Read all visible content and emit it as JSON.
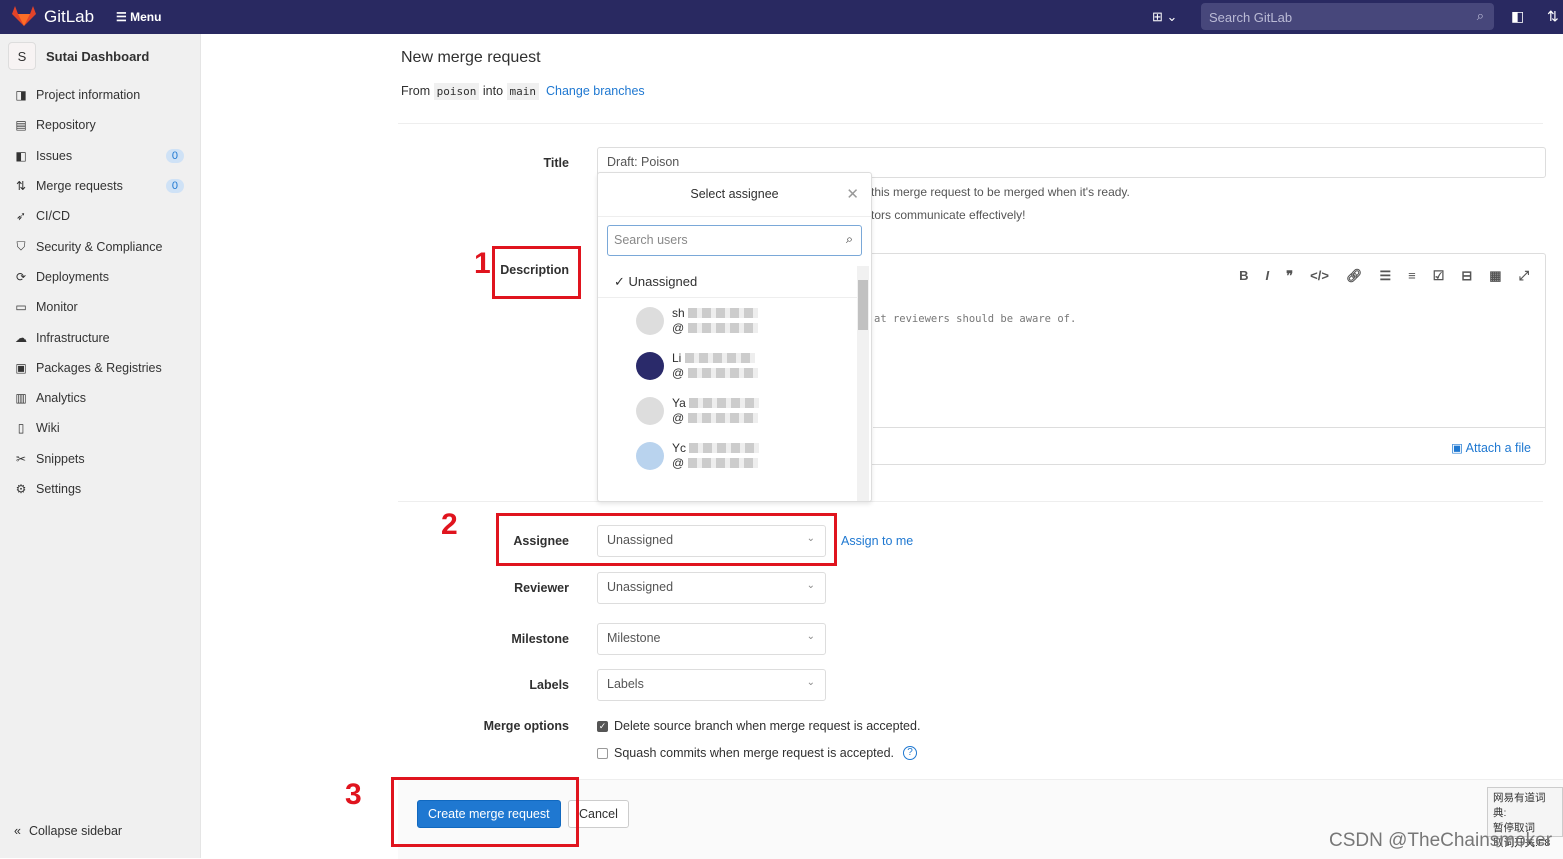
{
  "topbar": {
    "brand": "GitLab",
    "menu": "Menu",
    "search_placeholder": "Search GitLab"
  },
  "sidebar": {
    "project_initial": "S",
    "project_name": "Sutai Dashboard",
    "items": [
      {
        "label": "Project information",
        "icon": "info-icon"
      },
      {
        "label": "Repository",
        "icon": "doc-icon"
      },
      {
        "label": "Issues",
        "icon": "issues-icon",
        "badge": "0"
      },
      {
        "label": "Merge requests",
        "icon": "merge-icon",
        "badge": "0"
      },
      {
        "label": "CI/CD",
        "icon": "rocket-icon"
      },
      {
        "label": "Security & Compliance",
        "icon": "shield-icon"
      },
      {
        "label": "Deployments",
        "icon": "deploy-icon"
      },
      {
        "label": "Monitor",
        "icon": "monitor-icon"
      },
      {
        "label": "Infrastructure",
        "icon": "cloud-icon"
      },
      {
        "label": "Packages & Registries",
        "icon": "package-icon"
      },
      {
        "label": "Analytics",
        "icon": "chart-icon"
      },
      {
        "label": "Wiki",
        "icon": "book-icon"
      },
      {
        "label": "Snippets",
        "icon": "scissors-icon"
      },
      {
        "label": "Settings",
        "icon": "gear-icon"
      }
    ],
    "collapse": "Collapse sidebar"
  },
  "page": {
    "title": "New merge request",
    "from": "From",
    "source": "poison",
    "into": "into",
    "target": "main",
    "change_branches": "Change branches"
  },
  "form": {
    "title_label": "Title",
    "title_value": "Draft: Poison",
    "hint1": "this merge request to be merged when it's ready.",
    "hint2": "tors communicate effectively!",
    "description_label": "Description",
    "description_placeholder": "at reviewers should be aware of.",
    "attach": "Attach a file",
    "assignee_label": "Assignee",
    "assignee_value": "Unassigned",
    "assign_to_me": "Assign to me",
    "reviewer_label": "Reviewer",
    "reviewer_value": "Unassigned",
    "milestone_label": "Milestone",
    "milestone_value": "Milestone",
    "labels_label": "Labels",
    "labels_value": "Labels",
    "merge_options_label": "Merge options",
    "opt_delete": "Delete source branch when merge request is accepted.",
    "opt_delete_checked": true,
    "opt_squash": "Squash commits when merge request is accepted.",
    "opt_squash_checked": false
  },
  "dropdown": {
    "header": "Select assignee",
    "search_placeholder": "Search users",
    "unassigned": "Unassigned",
    "users": [
      {
        "name": "sh",
        "handle": "@"
      },
      {
        "name": "Li",
        "handle": "@"
      },
      {
        "name": "Ya",
        "handle": "@"
      },
      {
        "name": "Yc",
        "handle": "@"
      }
    ]
  },
  "actions": {
    "create": "Create merge request",
    "cancel": "Cancel"
  },
  "annotations": [
    "1",
    "2",
    "3"
  ],
  "overlay": {
    "line1": "网易有道词典:",
    "line2": "暂停取词",
    "line3": "取词开关:F8",
    "watermark": "CSDN @TheChainsmoker"
  },
  "colors": {
    "topbar": "#292961",
    "primary": "#1f78d1",
    "annotation": "#e0141e"
  }
}
